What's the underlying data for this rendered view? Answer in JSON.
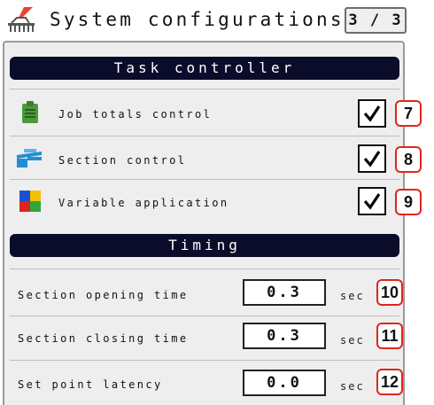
{
  "header": {
    "title": "System configurations",
    "page_indicator": "3 / 3",
    "icon": "field-implement-icon"
  },
  "task_controller": {
    "heading": "Task controller",
    "items": [
      {
        "label": "Job totals control",
        "icon": "clipboard-icon",
        "checked": true,
        "callout": "7"
      },
      {
        "label": "Section control",
        "icon": "sprayer-boom-icon",
        "checked": true,
        "callout": "8"
      },
      {
        "label": "Variable application",
        "icon": "color-grid-icon",
        "checked": true,
        "callout": "9"
      }
    ]
  },
  "timing": {
    "heading": "Timing",
    "items": [
      {
        "label": "Section opening time",
        "value": "0.3",
        "unit": "sec",
        "callout": "10"
      },
      {
        "label": "Section closing time",
        "value": "0.3",
        "unit": "sec",
        "callout": "11"
      },
      {
        "label": "Set point latency",
        "value": "0.0",
        "unit": "sec",
        "callout": "12"
      }
    ]
  },
  "colors": {
    "band_background": "#0b0c2a",
    "panel_background": "#eeeeee",
    "callout_border": "#e1251b",
    "accent_red": "#e8442f"
  }
}
